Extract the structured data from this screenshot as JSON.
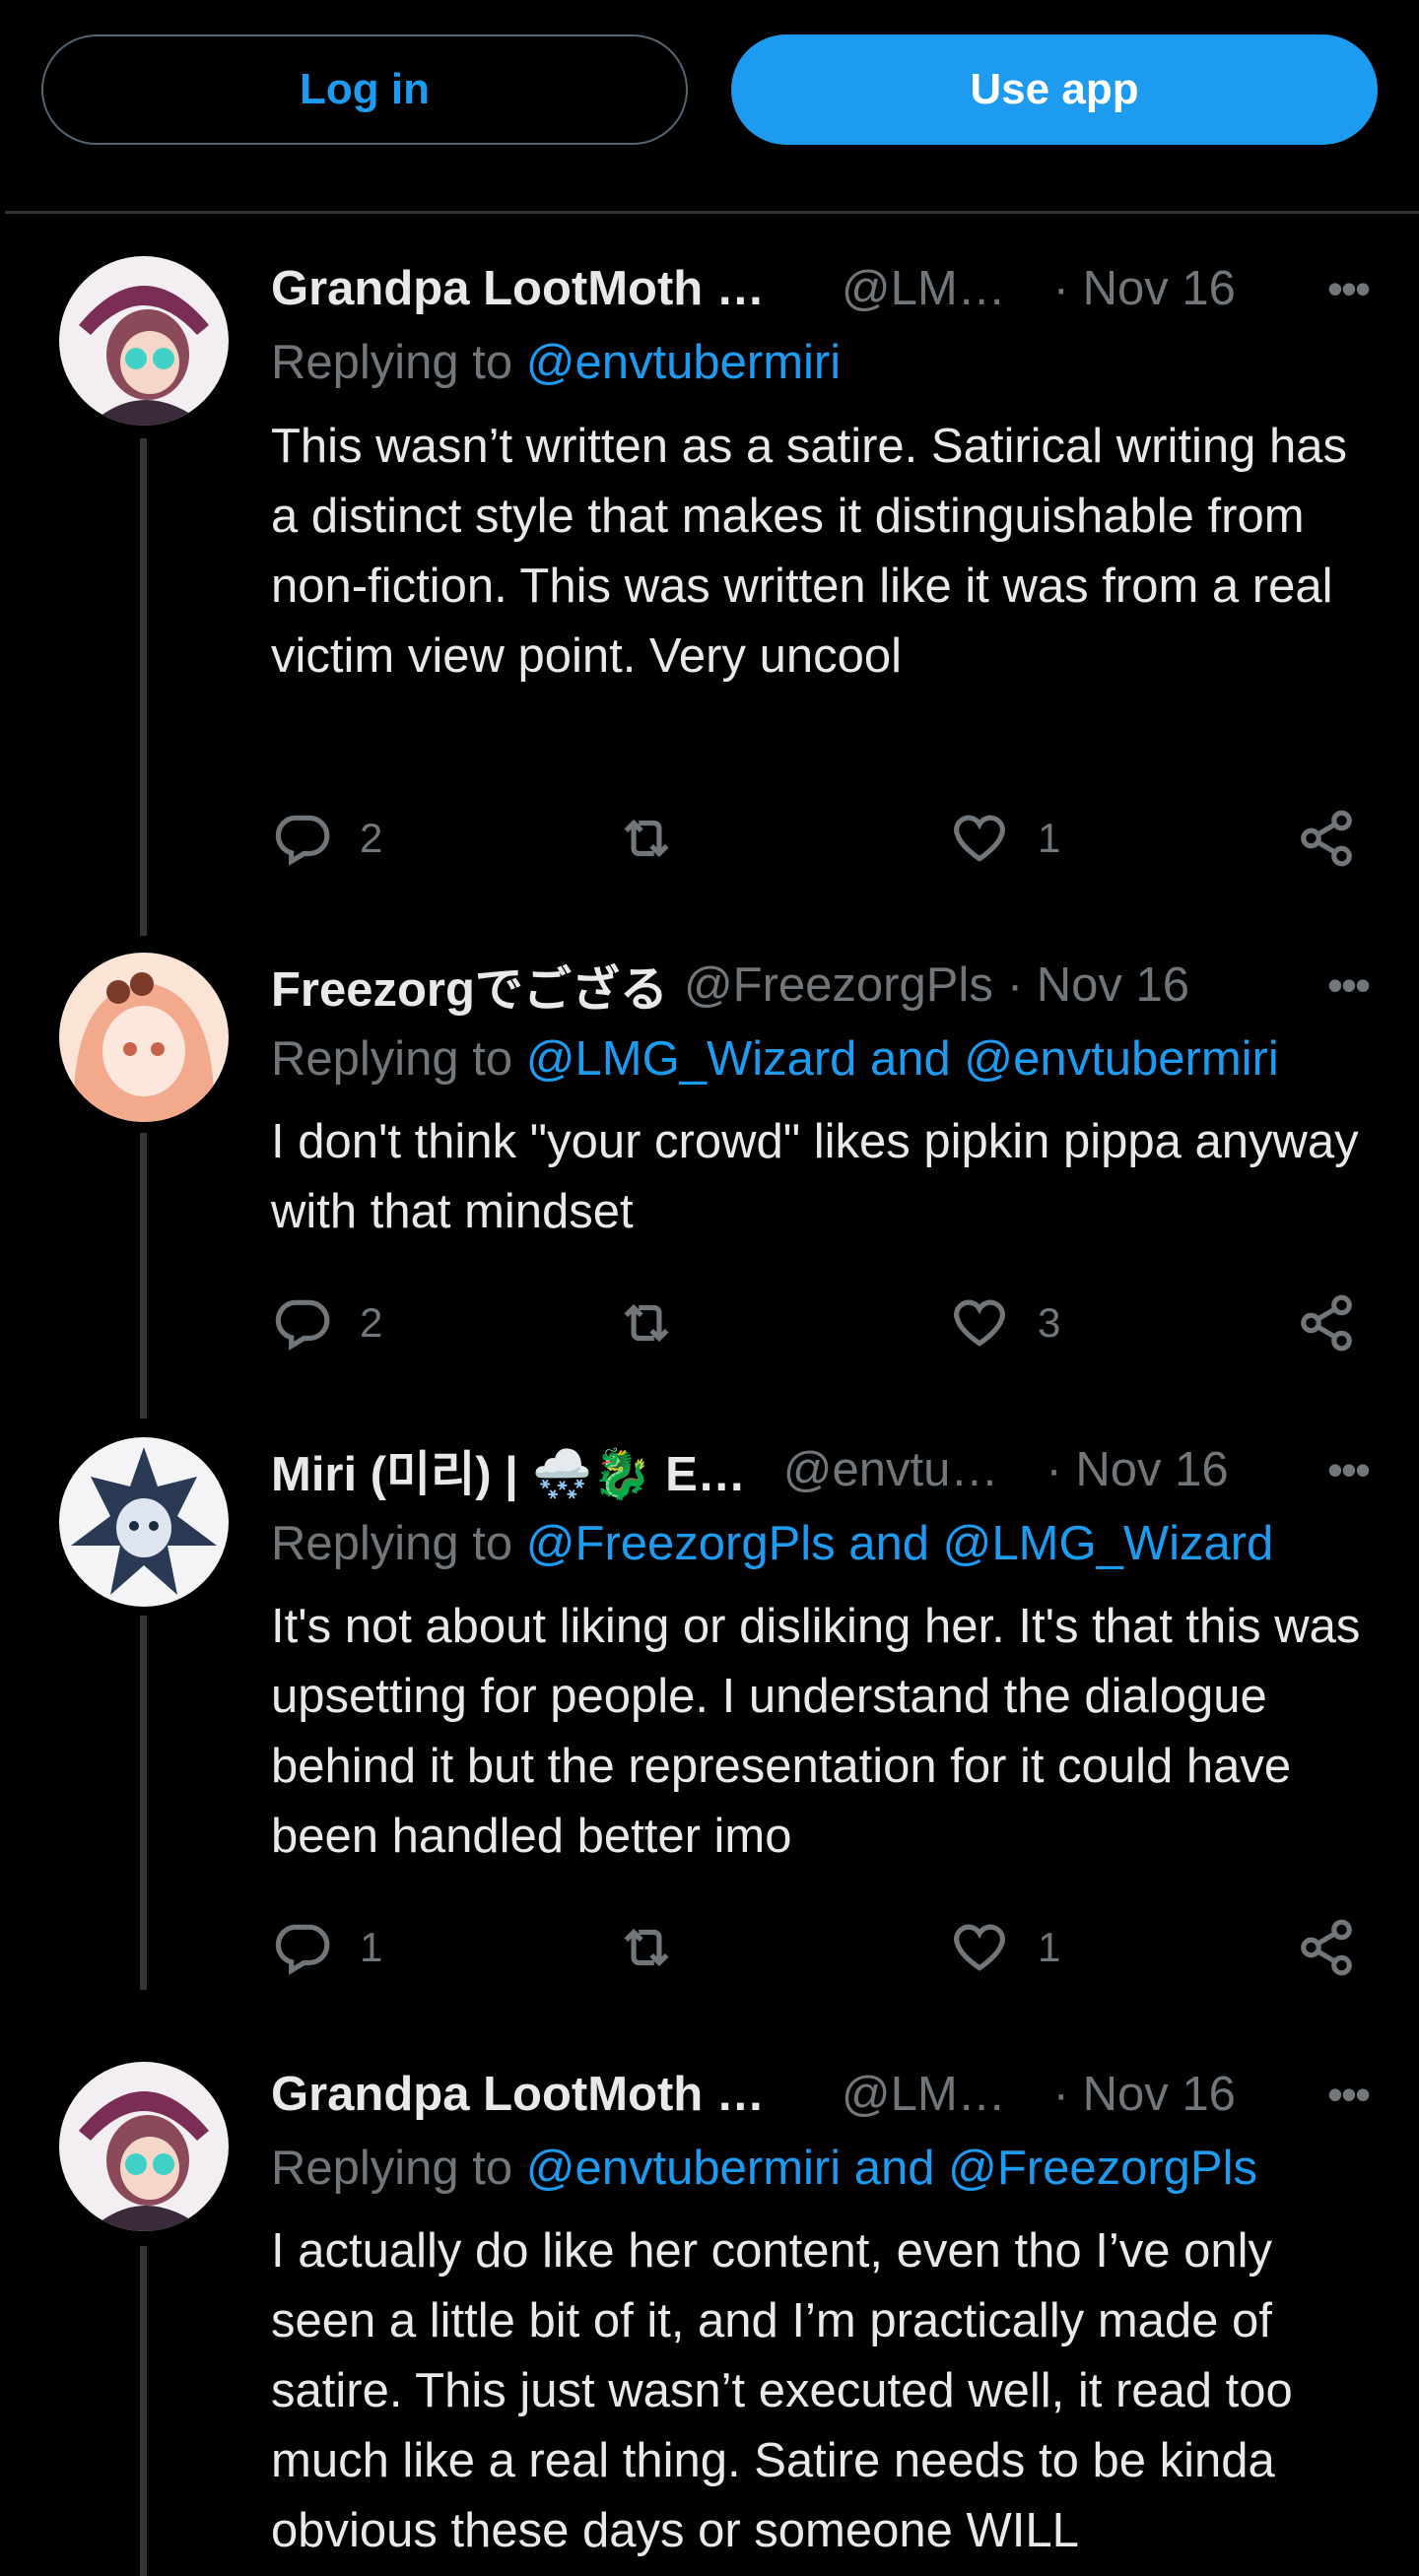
{
  "topbar": {
    "login_label": "Log in",
    "app_label": "Use app"
  },
  "tweets": [
    {
      "name": "Grandpa LootMoth …",
      "handle": "@LM…",
      "date": "· Nov 16",
      "replying_prefix": "Replying to",
      "replying_to": "@envtubermiri",
      "text": "This wasn’t written as a satire. Satirical writing has a distinct style that makes it distinguishable from non-fiction. This was written like it was from a real victim view point. Very uncool",
      "replies": "2",
      "retweets": "",
      "likes": "1"
    },
    {
      "name": "Freezorgでござる",
      "handle": "@FreezorgPls",
      "date": "· Nov 16",
      "replying_prefix": "Replying to",
      "replying_to": "@LMG_Wizard and @envtubermiri",
      "text": "I don't think \"your crowd\" likes pipkin pippa anyway with that mindset",
      "replies": "2",
      "retweets": "",
      "likes": "3"
    },
    {
      "name": "Miri (미리) | 🌨️🐉 E…",
      "handle": "@envtu…",
      "date": "· Nov 16",
      "replying_prefix": "Replying to",
      "replying_to": "@FreezorgPls and @LMG_Wizard",
      "text": "It's not about liking or disliking her. It's that this was upsetting for people. I understand the dialogue behind it but the representation for it could have been handled better imo",
      "replies": "1",
      "retweets": "",
      "likes": "1"
    },
    {
      "name": "Grandpa LootMoth …",
      "handle": "@LM…",
      "date": "· Nov 16",
      "replying_prefix": "Replying to",
      "replying_to": "@envtubermiri and @FreezorgPls",
      "text": "I actually do like her content, even tho I’ve only seen a little bit of it, and I’m practically made of satire. This just wasn’t executed well, it read too much like a real thing. Satire needs to be kinda obvious these days or someone WILL",
      "replies": "",
      "retweets": "",
      "likes": ""
    }
  ],
  "icons": {
    "more": "more-icon",
    "reply": "reply-icon",
    "retweet": "retweet-icon",
    "like": "like-icon",
    "share": "share-icon"
  },
  "colors": {
    "accent": "#1d9bf0",
    "muted": "#71767b",
    "text": "#e7e9ea",
    "bg": "#000000"
  }
}
